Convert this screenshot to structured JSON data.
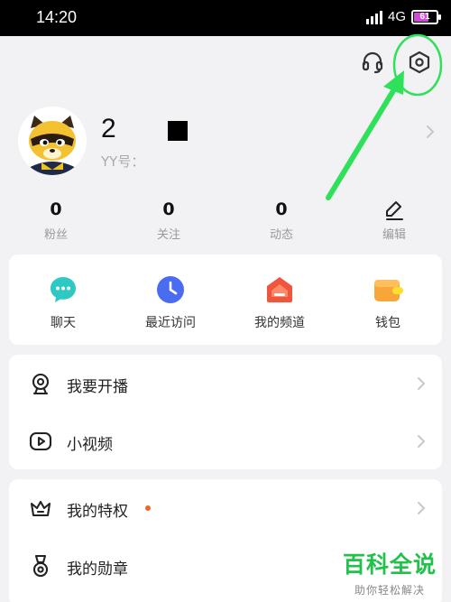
{
  "status_bar": {
    "time": "14:20",
    "network": "4G",
    "battery": "61",
    "battery_level": 0.61
  },
  "header": {
    "support_icon": "headset-icon",
    "settings_icon": "hexagon-settings-icon"
  },
  "profile": {
    "username": "2",
    "yy_id": "YY号：",
    "chevron": "chevron-right-icon"
  },
  "stats": [
    {
      "value": "0",
      "label": "粉丝"
    },
    {
      "value": "0",
      "label": "关注"
    },
    {
      "value": "0",
      "label": "动态"
    },
    {
      "label": "编辑",
      "icon": "pencil-icon"
    }
  ],
  "quick_actions": [
    {
      "label": "聊天",
      "icon": "chat-bubble-icon",
      "color": "#2ec9c2"
    },
    {
      "label": "最近访问",
      "icon": "clock-icon",
      "color": "#4a6cf0"
    },
    {
      "label": "我的频道",
      "icon": "channel-house-icon",
      "color": "#f0553d"
    },
    {
      "label": "钱包",
      "icon": "wallet-icon",
      "color": "#f8a53a"
    }
  ],
  "menu_group_1": [
    {
      "label": "我要开播",
      "icon": "webcam-icon"
    },
    {
      "label": "小视频",
      "icon": "video-play-icon"
    }
  ],
  "menu_group_2": [
    {
      "label": "我的特权",
      "icon": "crown-icon",
      "badge_color": "#f2662c"
    },
    {
      "label": "我的勋章",
      "icon": "medal-icon"
    }
  ],
  "annotation": {
    "color": "#2ee05a"
  },
  "watermark": {
    "title": "百科全说",
    "subtitle": "助你轻松解决"
  }
}
